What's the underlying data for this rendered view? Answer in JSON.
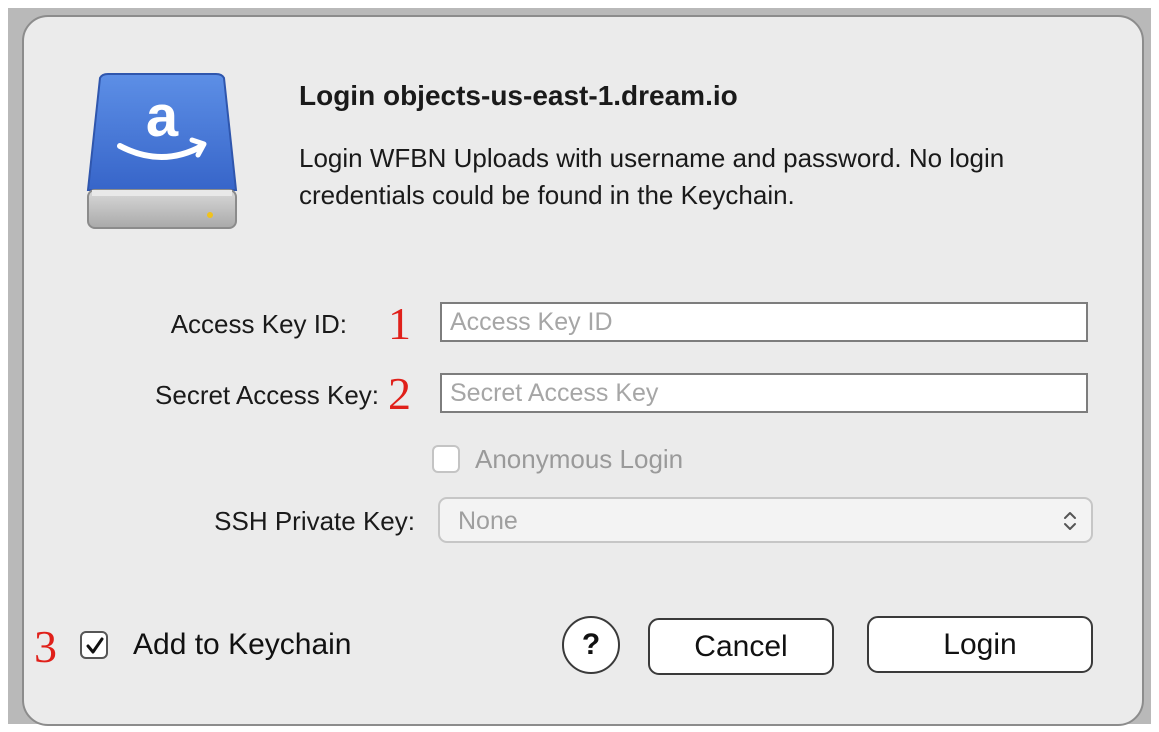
{
  "dialog": {
    "title": "Login objects-us-east-1.dream.io",
    "message": "Login WFBN Uploads with username and password. No login credentials could be found in the Keychain.",
    "icon": "amazon-drive-icon"
  },
  "fields": {
    "access_key": {
      "label": "Access Key ID:",
      "placeholder": "Access Key ID",
      "value": "",
      "marker": "1"
    },
    "secret_key": {
      "label": "Secret Access Key:",
      "placeholder": "Secret Access Key",
      "value": "",
      "marker": "2"
    },
    "anonymous": {
      "label": "Anonymous Login",
      "checked": false,
      "enabled": false
    },
    "ssh_key": {
      "label": "SSH Private Key:",
      "selected": "None",
      "enabled": false
    }
  },
  "footer": {
    "keychain": {
      "label": "Add to Keychain",
      "checked": true,
      "marker": "3"
    },
    "help_label": "?",
    "cancel_label": "Cancel",
    "login_label": "Login"
  },
  "colors": {
    "marker": "#e0201a",
    "drive_blue": "#3f6fd1",
    "dialog_bg": "#ebebeb"
  }
}
